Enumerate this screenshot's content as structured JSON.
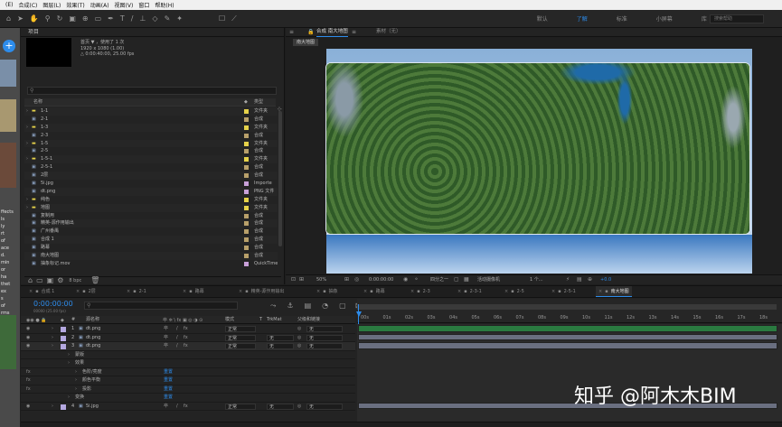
{
  "menu": {
    "items": [
      "(E)",
      "合成(C)",
      "图层(L)",
      "效果(T)",
      "动画(A)",
      "视图(V)",
      "窗口",
      "帮助(H)"
    ]
  },
  "workspaces": [
    "默认",
    "了解",
    "标准",
    "小屏幕",
    "库"
  ],
  "workspace_active": "了解",
  "search_placeholder": "搜索帮助",
  "project": {
    "title": "项目",
    "item_name": "首页 ▼ ，使用了 1 次",
    "item_size": "1920 x 1080 (1.00)",
    "item_duration": "△ 0:00:40:00, 25.00 fps",
    "col_name": "名称",
    "col_type": "类型",
    "rows": [
      {
        "name": "1-1",
        "type": "文件夹",
        "color": "#e6d24a"
      },
      {
        "name": "2-1",
        "type": "合成",
        "color": "#b8a06a"
      },
      {
        "name": "1-3",
        "type": "文件夹",
        "color": "#e6d24a"
      },
      {
        "name": "2-3",
        "type": "合成",
        "color": "#b8a06a"
      },
      {
        "name": "1-5",
        "type": "文件夹",
        "color": "#e6d24a"
      },
      {
        "name": "2-5",
        "type": "合成",
        "color": "#b8a06a"
      },
      {
        "name": "1-5-1",
        "type": "文件夹",
        "color": "#e6d24a"
      },
      {
        "name": "2-5-1",
        "type": "合成",
        "color": "#b8a06a"
      },
      {
        "name": "2层",
        "type": "合成",
        "color": "#b8a06a"
      },
      {
        "name": "5i.jpg",
        "type": "Importe",
        "color": "#c8a0d8"
      },
      {
        "name": "dt.png",
        "type": "PNG 文件",
        "color": "#c8a0d8"
      },
      {
        "name": "纯色",
        "type": "文件夹",
        "color": "#e6d24a"
      },
      {
        "name": "地图",
        "type": "文件夹",
        "color": "#e6d24a"
      },
      {
        "name": "复制用",
        "type": "合成",
        "color": "#b8a06a"
      },
      {
        "name": "精英-源作用输出",
        "type": "合成",
        "color": "#b8a06a"
      },
      {
        "name": "广州番禺",
        "type": "合成",
        "color": "#b8a06a"
      },
      {
        "name": "合成 1",
        "type": "合成",
        "color": "#b8a06a"
      },
      {
        "name": "路幕",
        "type": "合成",
        "color": "#b8a06a"
      },
      {
        "name": "南大地图",
        "type": "合成",
        "color": "#b8a06a"
      },
      {
        "name": "抽象标记.mov",
        "type": "QuickTime",
        "color": "#c8a0d8"
      }
    ],
    "bpc": "8 bpc"
  },
  "comp": {
    "tab_label": "合成 南大地图",
    "tab2_label": "素材（无）",
    "subtab": "南大地图",
    "zoom": "50%",
    "timecode": "0:00:00:00",
    "resolution": "四分之一",
    "camera": "活动摄像机",
    "views": "1 个..."
  },
  "timeline": {
    "tabs": [
      "合成 1",
      "2层",
      "2-1",
      "路幕",
      "精英-源作用输出",
      "抽象",
      "路幕",
      "2-3",
      "2-3-1",
      "2-5",
      "2-5-1",
      "南大地图"
    ],
    "active_tab": "南大地图",
    "timecode": "0:00:00:00",
    "timecode_sub": "00000 (25.00 fps)",
    "columns": {
      "source": "源名称",
      "mode": "模式",
      "trkmat": "TrkMat",
      "parent": "父级和链接"
    },
    "layers": [
      {
        "num": "1",
        "name": "dt.png",
        "mode": "正常",
        "trk": "",
        "parent": "无",
        "color": "#b4a8e0"
      },
      {
        "num": "2",
        "name": "dt.png",
        "mode": "正常",
        "trk": "无",
        "parent": "无",
        "color": "#b4a8e0"
      },
      {
        "num": "3",
        "name": "dt.png",
        "mode": "正常",
        "trk": "无",
        "parent": "无",
        "color": "#b4a8e0"
      }
    ],
    "props": [
      {
        "label": "蒙版",
        "indent": 1
      },
      {
        "label": "效果",
        "indent": 1
      },
      {
        "label": "色阶/亮度",
        "indent": 2,
        "value": "重置"
      },
      {
        "label": "颜色平衡",
        "indent": 2,
        "value": "重置"
      },
      {
        "label": "投影",
        "indent": 2,
        "value": "重置"
      },
      {
        "label": "变换",
        "indent": 1,
        "value": "重置"
      }
    ],
    "layer4": {
      "num": "4",
      "name": "5i.jpg",
      "mode": "正常",
      "trk": "无",
      "parent": "无"
    },
    "ruler_ticks": [
      "00s",
      "01s",
      "02s",
      "03s",
      "04s",
      "05s",
      "06s",
      "07s",
      "08s",
      "09s",
      "10s",
      "11s",
      "12s",
      "13s",
      "14s",
      "15s",
      "16s",
      "17s",
      "18s"
    ]
  },
  "watermark": "知乎 @阿木木BIM",
  "left_strip_texts": [
    "ffects",
    "ls",
    "ly",
    "rt",
    "of",
    "ace",
    "d.",
    "min",
    "or",
    "ha",
    "thet",
    "ex",
    "s",
    "of",
    "rms"
  ]
}
